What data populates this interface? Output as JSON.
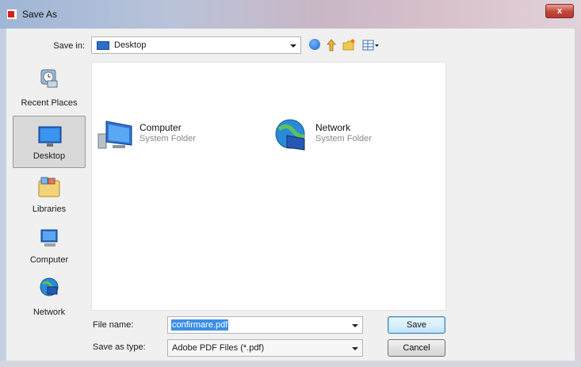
{
  "window": {
    "title": "Save As",
    "close_label": "x"
  },
  "toolbar": {
    "save_in_label": "Save in:",
    "save_in_value": "Desktop",
    "icons": [
      "back-icon",
      "up-folder-icon",
      "new-folder-icon",
      "views-menu-icon"
    ]
  },
  "places": [
    {
      "label": "Recent Places",
      "icon": "recent-places-icon"
    },
    {
      "label": "Desktop",
      "icon": "desktop-icon",
      "selected": true
    },
    {
      "label": "Libraries",
      "icon": "libraries-icon"
    },
    {
      "label": "Computer",
      "icon": "computer-icon"
    },
    {
      "label": "Network",
      "icon": "network-icon"
    }
  ],
  "files": [
    {
      "name": "Computer",
      "type": "System Folder",
      "icon": "computer-icon"
    },
    {
      "name": "Network",
      "type": "System Folder",
      "icon": "network-globe-icon"
    }
  ],
  "form": {
    "file_name_label": "File name:",
    "file_name_value": "confirmare.pdf",
    "save_as_type_label": "Save as type:",
    "save_as_type_value": "Adobe PDF Files (*.pdf)"
  },
  "buttons": {
    "save": "Save",
    "cancel": "Cancel"
  },
  "colors": {
    "selection": "#3a8ee6",
    "close_button": "#c2473a"
  }
}
